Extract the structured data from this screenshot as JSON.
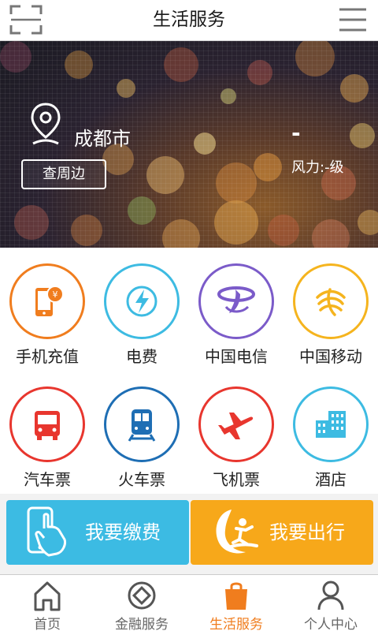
{
  "header": {
    "title": "生活服务",
    "left_icon": "scan-icon",
    "right_icon": "menu-icon"
  },
  "banner": {
    "city": "成都市",
    "nearby_label": "查周边",
    "temperature": "-",
    "wind": "风力:-级"
  },
  "services": [
    {
      "label": "手机充值",
      "icon": "phone-recharge-icon",
      "color": "#f07d1e"
    },
    {
      "label": "电费",
      "icon": "electricity-icon",
      "color": "#3dbbe2"
    },
    {
      "label": "中国电信",
      "icon": "china-telecom-icon",
      "color": "#7b5bc9"
    },
    {
      "label": "中国移动",
      "icon": "china-mobile-icon",
      "color": "#f5b41e"
    },
    {
      "label": "汽车票",
      "icon": "bus-icon",
      "color": "#e8362e"
    },
    {
      "label": "火车票",
      "icon": "train-icon",
      "color": "#1e6eb4"
    },
    {
      "label": "飞机票",
      "icon": "airplane-icon",
      "color": "#e8362e"
    },
    {
      "label": "酒店",
      "icon": "hotel-icon",
      "color": "#3dbbe2"
    }
  ],
  "actions": [
    {
      "label": "我要缴费",
      "icon": "hand-phone-icon",
      "color": "#3cbbe3"
    },
    {
      "label": "我要出行",
      "icon": "surfer-icon",
      "color": "#f7a81a"
    }
  ],
  "tabs": [
    {
      "label": "首页",
      "icon": "home-icon",
      "active": false
    },
    {
      "label": "金融服务",
      "icon": "finance-icon",
      "active": false
    },
    {
      "label": "生活服务",
      "icon": "shopping-bag-icon",
      "active": true
    },
    {
      "label": "个人中心",
      "icon": "person-icon",
      "active": false
    }
  ],
  "colors": {
    "accent": "#f07d1e",
    "tab_inactive": "#666666"
  }
}
